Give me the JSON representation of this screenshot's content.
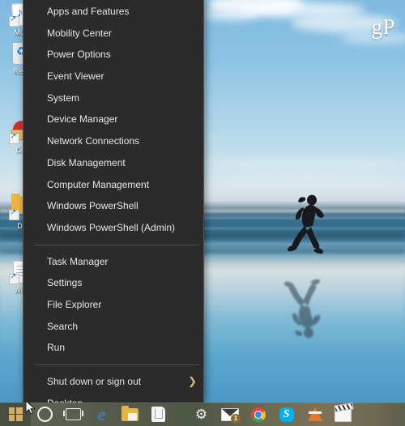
{
  "desktop": {
    "wallpaper_description": "Beach scene with runner silhouette and reflection",
    "watermark": "gP",
    "icons": [
      {
        "label": "Musi",
        "icon": "music-note-icon",
        "shortcut": true
      },
      {
        "label": "Recy",
        "icon": "recycle-bin-icon",
        "shortcut": false
      },
      {
        "label": "CCl",
        "icon": "ccleaner-icon",
        "shortcut": true
      },
      {
        "label": "Do",
        "icon": "folder-icon",
        "shortcut": true
      },
      {
        "label": "Wi U",
        "icon": "document-icon",
        "shortcut": true
      }
    ]
  },
  "winx_menu": {
    "name": "Windows power user menu",
    "groups": [
      {
        "items": [
          {
            "label": "Apps and Features",
            "submenu": false
          },
          {
            "label": "Mobility Center",
            "submenu": false
          },
          {
            "label": "Power Options",
            "submenu": false
          },
          {
            "label": "Event Viewer",
            "submenu": false
          },
          {
            "label": "System",
            "submenu": false
          },
          {
            "label": "Device Manager",
            "submenu": false
          },
          {
            "label": "Network Connections",
            "submenu": false
          },
          {
            "label": "Disk Management",
            "submenu": false
          },
          {
            "label": "Computer Management",
            "submenu": false
          },
          {
            "label": "Windows PowerShell",
            "submenu": false
          },
          {
            "label": "Windows PowerShell (Admin)",
            "submenu": false
          }
        ]
      },
      {
        "items": [
          {
            "label": "Task Manager",
            "submenu": false
          },
          {
            "label": "Settings",
            "submenu": false
          },
          {
            "label": "File Explorer",
            "submenu": false
          },
          {
            "label": "Search",
            "submenu": false
          },
          {
            "label": "Run",
            "submenu": false
          }
        ]
      },
      {
        "items": [
          {
            "label": "Shut down or sign out",
            "submenu": true,
            "submenu_glyph": "❯"
          },
          {
            "label": "Desktop",
            "submenu": false
          }
        ]
      }
    ]
  },
  "taskbar": {
    "buttons": [
      {
        "name": "start-button",
        "icon": "windows-logo-icon",
        "title": "Start",
        "active": true
      },
      {
        "name": "cortana-button",
        "icon": "cortana-circle-icon",
        "title": "Cortana"
      },
      {
        "name": "task-view-button",
        "icon": "task-view-icon",
        "title": "Task View"
      },
      {
        "name": "edge-button",
        "icon": "microsoft-edge-icon",
        "title": "Microsoft Edge"
      },
      {
        "name": "file-explorer-button",
        "icon": "file-explorer-icon",
        "title": "File Explorer"
      },
      {
        "name": "store-button",
        "icon": "microsoft-store-icon",
        "title": "Store"
      },
      {
        "name": "settings-button",
        "icon": "gear-icon",
        "title": "Settings"
      },
      {
        "name": "mail-button",
        "icon": "mail-envelope-icon",
        "title": "Mail",
        "badge": "1"
      },
      {
        "name": "chrome-button",
        "icon": "google-chrome-icon",
        "title": "Google Chrome"
      },
      {
        "name": "skype-button",
        "icon": "skype-icon",
        "title": "Skype",
        "glyph": "S"
      },
      {
        "name": "vlc-button",
        "icon": "vlc-cone-icon",
        "title": "VLC media player"
      },
      {
        "name": "movies-button",
        "icon": "movie-clapperboard-icon",
        "title": "Movies & TV"
      }
    ]
  },
  "colors": {
    "menu_background": "#2b2b2b",
    "menu_text": "#e6e6e6",
    "menu_border": "#545454",
    "separator": "#4d4d4d",
    "submenu_arrow": "#d6b97a",
    "taskbar": "#565d4d",
    "start_logo": "#d9ab63"
  }
}
